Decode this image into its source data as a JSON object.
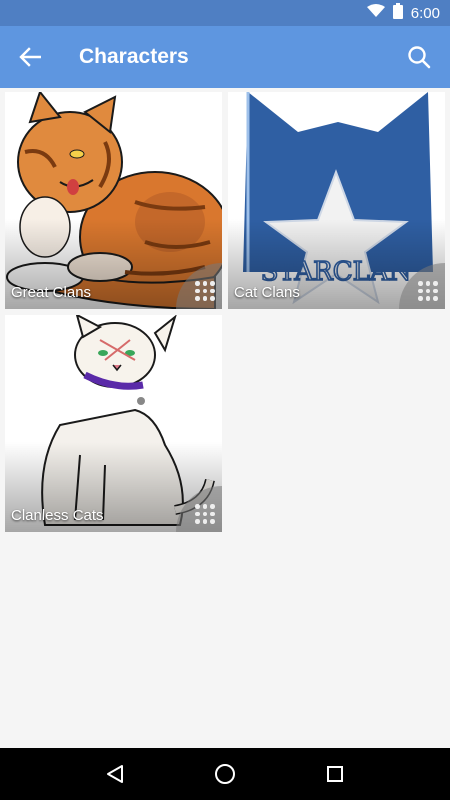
{
  "status_bar": {
    "time": "6:00",
    "icons": [
      "wifi-icon",
      "battery-icon"
    ]
  },
  "app_bar": {
    "title": "Characters",
    "back_icon": "arrow-left-icon",
    "search_icon": "search-icon"
  },
  "tiles": [
    {
      "label": "Great Clans",
      "image": "orange-tabby-cat",
      "menu_icon": "grid-dots-icon"
    },
    {
      "label": "Cat Clans",
      "image": "starclan-emblem",
      "menu_icon": "grid-dots-icon"
    },
    {
      "label": "Clanless Cats",
      "image": "white-cat-with-collar",
      "menu_icon": "grid-dots-icon"
    }
  ],
  "nav_bar": {
    "icons": [
      "back-triangle-icon",
      "home-circle-icon",
      "recents-square-icon"
    ]
  },
  "colors": {
    "status_bar": "#4f7fc3",
    "app_bar": "#5e96e0",
    "background": "#f5f5f5"
  }
}
